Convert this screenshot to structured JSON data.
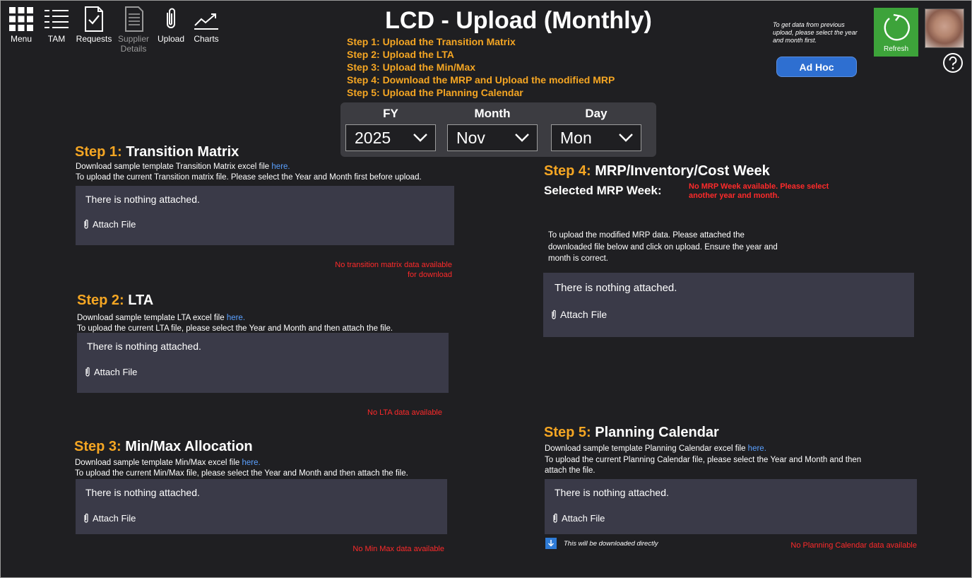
{
  "nav": {
    "items": [
      {
        "label": "Menu"
      },
      {
        "label": "TAM"
      },
      {
        "label": "Requests"
      },
      {
        "label": "Supplier",
        "label2": "Details"
      },
      {
        "label": "Upload"
      },
      {
        "label": "Charts"
      }
    ]
  },
  "header": {
    "title": "LCD - Upload (Monthly)",
    "steps": [
      "Step 1: Upload the Transition Matrix",
      "Step 2: Upload the LTA",
      "Step 3: Upload the Min/Max",
      "Step 4: Download the MRP and Upload the modified MRP",
      "Step 5: Upload the Planning Calendar"
    ]
  },
  "selectors": {
    "fy": {
      "label": "FY",
      "value": "2025"
    },
    "month": {
      "label": "Month",
      "value": "Nov"
    },
    "day": {
      "label": "Day",
      "value": "Mon"
    }
  },
  "topright": {
    "adhoc_note": "To get data from previous upload, please select the year and month first.",
    "adhoc_label": "Ad Hoc",
    "refresh_label": "Refresh"
  },
  "common": {
    "nothing_attached": "There is nothing attached.",
    "attach_file": "Attach File"
  },
  "step1": {
    "num": "Step 1:",
    "name": "Transition Matrix",
    "line1": "Download sample template Transition Matrix excel file",
    "link": "here.",
    "line2": "To upload the current Transition matrix file. Please select the Year and Month first before upload.",
    "msg1": "No transition matrix data available",
    "msg2": "for download"
  },
  "step2": {
    "num": "Step 2:",
    "name": "LTA",
    "line1": "Download sample template LTA excel file",
    "link": "here.",
    "line2": "To upload the current LTA file, please select the Year and Month and then attach the file.",
    "msg": "No LTA data available"
  },
  "step3": {
    "num": "Step 3:",
    "name": "Min/Max Allocation",
    "line1": "Download sample template Min/Max excel file",
    "link": "here.",
    "line2": "To upload the current Min/Max file, please select the Year and Month and then attach the file.",
    "msg": "No Min Max data available"
  },
  "step4": {
    "num": "Step 4:",
    "name": "MRP/Inventory/Cost Week",
    "week_label": "Selected MRP Week:",
    "week_msg": "No MRP Week available. Please select another year and month.",
    "instr1": "To upload the modified MRP data. Please attached the",
    "instr2": "downloaded file below and click on upload. Ensure the year and",
    "instr3": "month is correct."
  },
  "step5": {
    "num": "Step 5:",
    "name": "Planning Calendar",
    "line1": "Download sample template Planning Calendar excel file",
    "link": "here.",
    "line2": "To upload the current Planning Calendar file, please select the Year and Month and then",
    "line3": "attach the file.",
    "download_note": "This will be downloaded directly",
    "msg": "No Planning Calendar data available"
  }
}
